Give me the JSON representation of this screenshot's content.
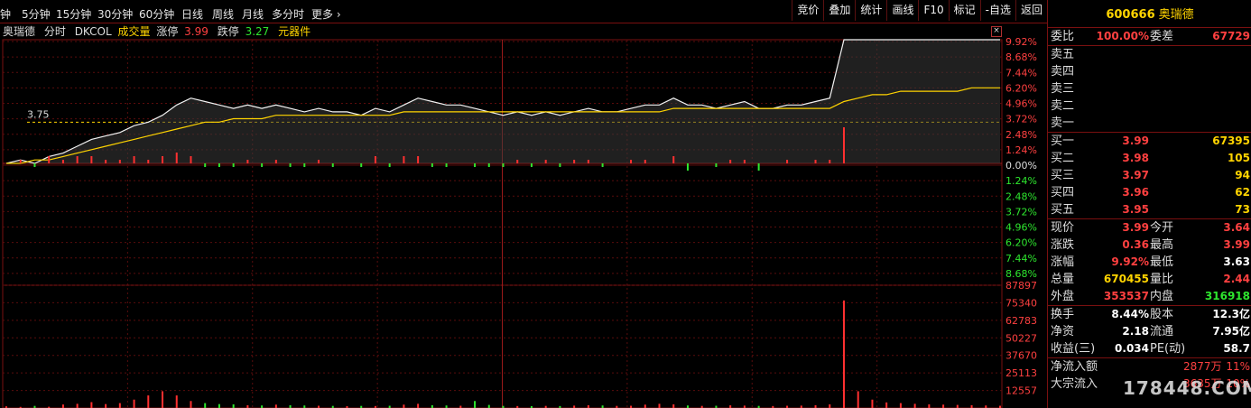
{
  "timeframes": [
    "钟",
    "5分钟",
    "15分钟",
    "30分钟",
    "60分钟",
    "日线",
    "周线",
    "月线",
    "多分时",
    "更多 ›"
  ],
  "tools": [
    "竞价",
    "叠加",
    "统计",
    "画线",
    "F10",
    "标记",
    "-自选",
    "返回"
  ],
  "info": {
    "name": "奥瑞德",
    "mode": "分时",
    "indicator": "DKCOL",
    "vol_label": "成交量",
    "zt_label": "涨停",
    "zt_val": "3.99",
    "dt_label": "跌停",
    "dt_val": "3.27",
    "sector": "元器件"
  },
  "price_axis": [
    "9.92%",
    "8.68%",
    "7.44%",
    "6.20%",
    "4.96%",
    "3.72%",
    "2.48%",
    "1.24%",
    "0.00%",
    "1.24%",
    "2.48%",
    "3.72%",
    "4.96%",
    "6.20%",
    "7.44%",
    "8.68%"
  ],
  "vol_axis": [
    "87897",
    "75340",
    "62783",
    "50227",
    "37670",
    "25113",
    "12557"
  ],
  "level_label": "3.75",
  "chart_data": {
    "type": "line",
    "prev_close": 3.63,
    "price_series": [
      3.63,
      3.64,
      3.63,
      3.65,
      3.66,
      3.68,
      3.7,
      3.71,
      3.72,
      3.74,
      3.75,
      3.77,
      3.8,
      3.82,
      3.81,
      3.8,
      3.79,
      3.8,
      3.79,
      3.8,
      3.79,
      3.78,
      3.79,
      3.78,
      3.78,
      3.77,
      3.79,
      3.78,
      3.8,
      3.82,
      3.81,
      3.8,
      3.8,
      3.79,
      3.78,
      3.77,
      3.78,
      3.77,
      3.78,
      3.77,
      3.78,
      3.79,
      3.78,
      3.78,
      3.79,
      3.8,
      3.8,
      3.82,
      3.8,
      3.8,
      3.79,
      3.8,
      3.81,
      3.79,
      3.79,
      3.8,
      3.8,
      3.81,
      3.82,
      3.99,
      3.99,
      3.99,
      3.99,
      3.99,
      3.99,
      3.99,
      3.99,
      3.99,
      3.99,
      3.99,
      3.99
    ],
    "avg_series": [
      3.63,
      3.63,
      3.64,
      3.64,
      3.65,
      3.66,
      3.67,
      3.68,
      3.69,
      3.7,
      3.71,
      3.72,
      3.73,
      3.74,
      3.75,
      3.75,
      3.76,
      3.76,
      3.76,
      3.77,
      3.77,
      3.77,
      3.77,
      3.77,
      3.77,
      3.77,
      3.77,
      3.77,
      3.78,
      3.78,
      3.78,
      3.78,
      3.78,
      3.78,
      3.78,
      3.78,
      3.78,
      3.78,
      3.78,
      3.78,
      3.78,
      3.78,
      3.78,
      3.78,
      3.78,
      3.78,
      3.78,
      3.79,
      3.79,
      3.79,
      3.79,
      3.79,
      3.79,
      3.79,
      3.79,
      3.79,
      3.79,
      3.79,
      3.79,
      3.81,
      3.82,
      3.83,
      3.83,
      3.84,
      3.84,
      3.84,
      3.84,
      3.84,
      3.85,
      3.85,
      3.85
    ],
    "y_range_pct": [
      -9.92,
      9.92
    ],
    "volume_max": 87897,
    "volume": [
      1200,
      800,
      1500,
      900,
      2500,
      3000,
      4200,
      2800,
      3500,
      6000,
      9000,
      12000,
      9000,
      5000,
      3500,
      2800,
      2600,
      2000,
      1800,
      2400,
      2000,
      1800,
      1600,
      1500,
      1300,
      1500,
      1400,
      1600,
      2400,
      3000,
      2000,
      1800,
      1600,
      5000,
      2200,
      1500,
      1400,
      1300,
      1500,
      1400,
      1700,
      2000,
      1800,
      1500,
      1600,
      2400,
      3000,
      2600,
      1800,
      1500,
      1600,
      1900,
      1700,
      1500,
      1400,
      1600,
      1700,
      2000,
      2600,
      77000,
      12000,
      6000,
      4000,
      3500,
      3000,
      2600,
      2400,
      2200,
      2000,
      1800,
      1600
    ]
  },
  "quote": {
    "code": "600666",
    "name": "奥瑞德",
    "wb_label": "委比",
    "wb": "100.00%",
    "wc_label": "委差",
    "wc": "67729",
    "sells": [
      {
        "label": "卖五"
      },
      {
        "label": "卖四"
      },
      {
        "label": "卖三"
      },
      {
        "label": "卖二"
      },
      {
        "label": "卖一"
      }
    ],
    "buys": [
      {
        "label": "买一",
        "price": "3.99",
        "vol": "67395"
      },
      {
        "label": "买二",
        "price": "3.98",
        "vol": "105"
      },
      {
        "label": "买三",
        "price": "3.97",
        "vol": "94"
      },
      {
        "label": "买四",
        "price": "3.96",
        "vol": "62"
      },
      {
        "label": "买五",
        "price": "3.95",
        "vol": "73"
      }
    ],
    "stats": [
      {
        "l1": "现价",
        "v1": "3.99",
        "c1": "red",
        "l2": "今开",
        "v2": "3.64",
        "c2": "red"
      },
      {
        "l1": "涨跌",
        "v1": "0.36",
        "c1": "red",
        "l2": "最高",
        "v2": "3.99",
        "c2": "red"
      },
      {
        "l1": "涨幅",
        "v1": "9.92%",
        "c1": "red",
        "l2": "最低",
        "v2": "3.63",
        "c2": "wht"
      },
      {
        "l1": "总量",
        "v1": "670455",
        "c1": "yel",
        "l2": "量比",
        "v2": "2.44",
        "c2": "red"
      },
      {
        "l1": "外盘",
        "v1": "353537",
        "c1": "red",
        "l2": "内盘",
        "v2": "316918",
        "c2": "green"
      }
    ],
    "stats2": [
      {
        "l1": "换手",
        "v1": "8.44%",
        "l2": "股本",
        "v2": "12.3亿"
      },
      {
        "l1": "净资",
        "v1": "2.18",
        "l2": "流通",
        "v2": "7.95亿"
      },
      {
        "l1": "收益(三)",
        "v1": "0.034",
        "l2": "PE(动)",
        "v2": "58.7"
      }
    ],
    "flow": [
      {
        "label": "净流入额",
        "val": "2877万",
        "pct": "11%"
      },
      {
        "label": "大宗流入",
        "val": "3635万",
        "pct": "10%"
      }
    ]
  },
  "watermark": "178448.COM"
}
